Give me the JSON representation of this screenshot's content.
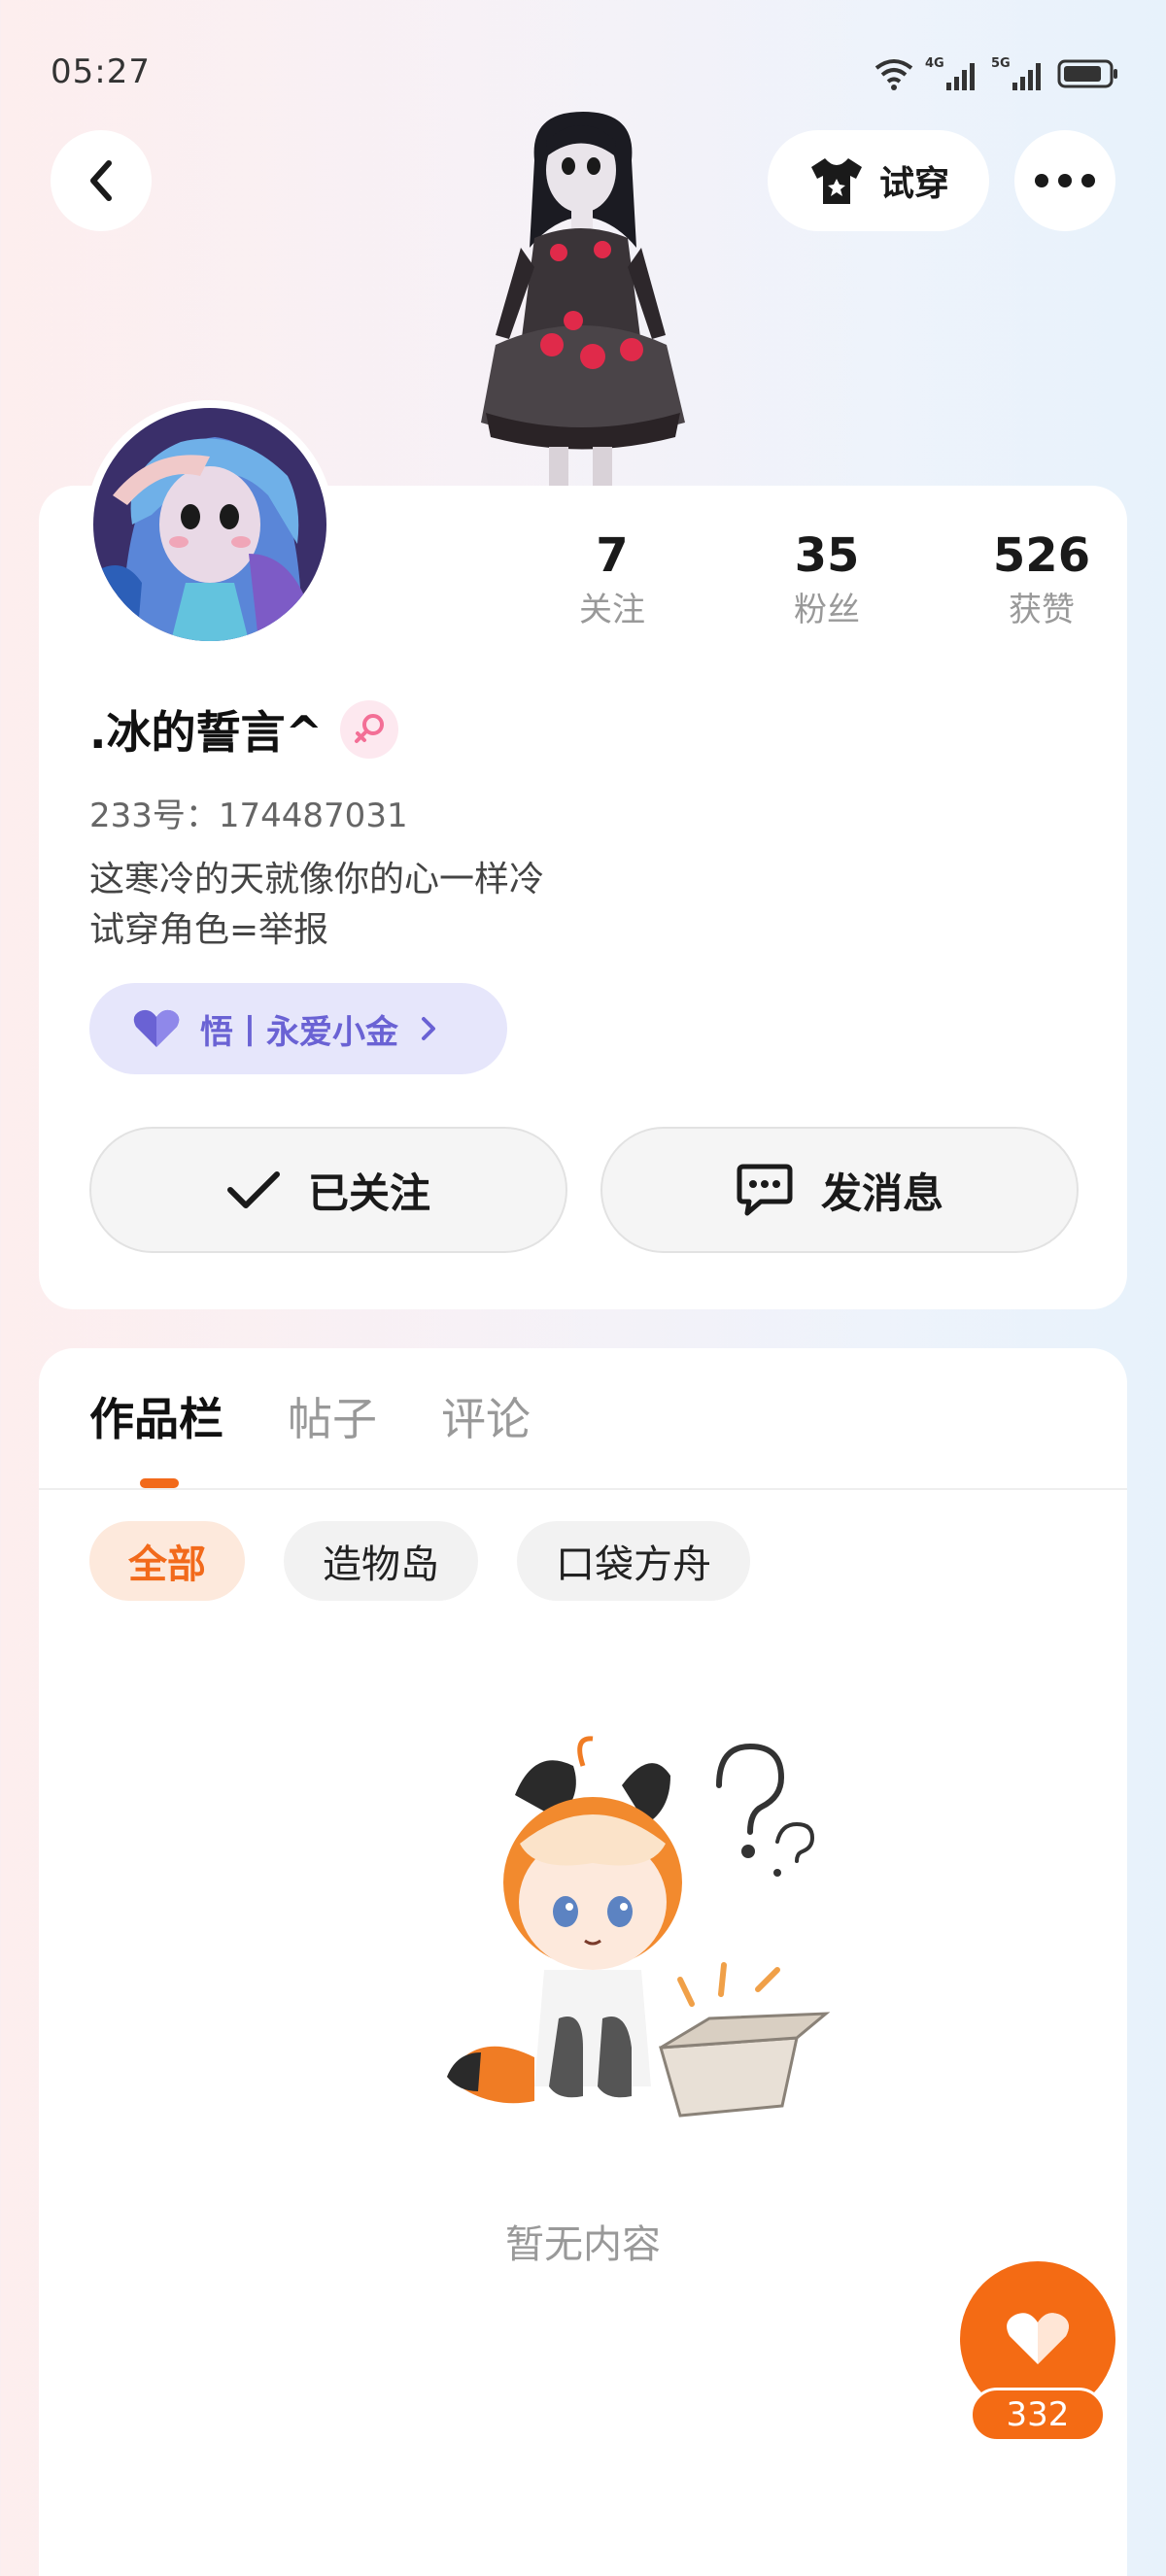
{
  "status_bar": {
    "time": "05:27",
    "net1": "4G",
    "net2": "5G"
  },
  "header": {
    "tryon_label": "试穿"
  },
  "stats": [
    {
      "value": "7",
      "label": "关注"
    },
    {
      "value": "35",
      "label": "粉丝"
    },
    {
      "value": "526",
      "label": "获赞"
    }
  ],
  "profile": {
    "nickname": ".冰的誓言^",
    "uid": "233号：174487031",
    "bio_line1": "这寒冷的天就像你的心一样冷",
    "bio_line2": "试穿角色=举报",
    "fan_badge": "悟丨永爱小金"
  },
  "actions": {
    "follow_label": "已关注",
    "message_label": "发消息"
  },
  "tabs": [
    {
      "label": "作品栏"
    },
    {
      "label": "帖子"
    },
    {
      "label": "评论"
    }
  ],
  "filters": [
    {
      "label": "全部"
    },
    {
      "label": "造物岛"
    },
    {
      "label": "口袋方舟"
    }
  ],
  "empty_state": {
    "text": "暂无内容"
  },
  "fab": {
    "count": "332"
  },
  "colors": {
    "accent": "#f46b14",
    "badge_purple": "#6a62d4",
    "badge_bg": "#e6e6fb"
  }
}
